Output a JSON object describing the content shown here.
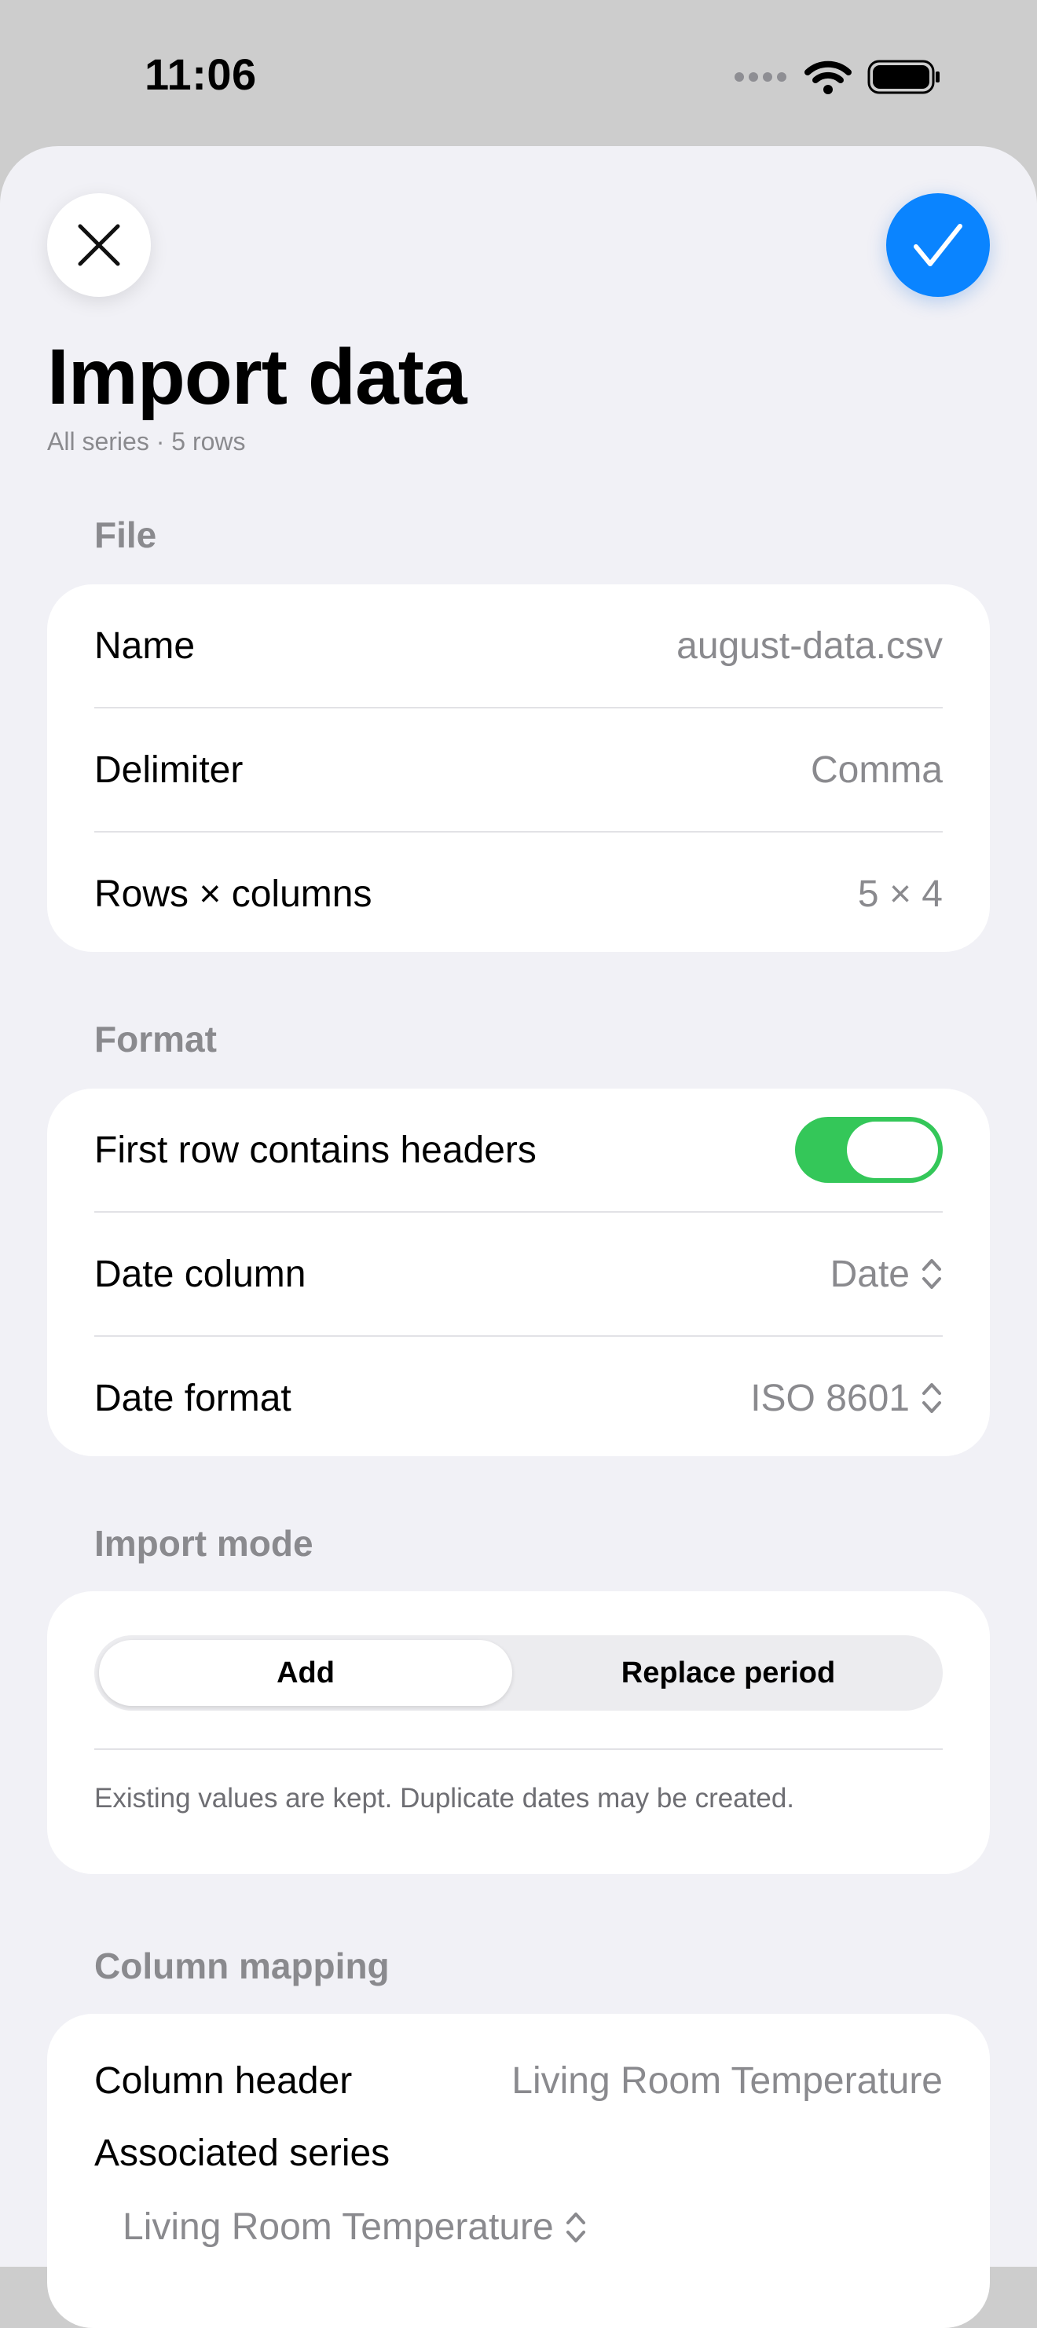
{
  "status_bar": {
    "time": "11:06",
    "icons": [
      "signal-dots-icon",
      "wifi-icon",
      "battery-icon"
    ]
  },
  "header": {
    "close_icon": "close-icon",
    "confirm_icon": "checkmark-icon",
    "title": "Import data",
    "subtitle": "All series · 5 rows"
  },
  "file_section": {
    "header": "File",
    "rows": [
      {
        "label": "Name",
        "value": "august-data.csv"
      },
      {
        "label": "Delimiter",
        "value": "Comma"
      },
      {
        "label": "Rows × columns",
        "value": "5 × 4"
      }
    ]
  },
  "format_section": {
    "header": "Format",
    "headers_row": {
      "label": "First row contains headers",
      "toggle_on": true
    },
    "date_column": {
      "label": "Date column",
      "value": "Date"
    },
    "date_format": {
      "label": "Date format",
      "value": "ISO 8601"
    }
  },
  "import_mode": {
    "header": "Import mode",
    "options": [
      "Add",
      "Replace period"
    ],
    "selected": "Add",
    "footnote": "Existing values are kept. Duplicate dates may be created."
  },
  "column_mapping": {
    "header": "Column mapping",
    "column_header_label": "Column header",
    "column_header_value": "Living Room Temperature",
    "associated_series_label": "Associated series",
    "associated_series_value": "Living Room Temperature"
  },
  "colors": {
    "accent": "#0a84ff",
    "toggle_on": "#34c759",
    "sheet_bg": "#f1f1f6",
    "secondary_text": "#8a8a8e"
  }
}
